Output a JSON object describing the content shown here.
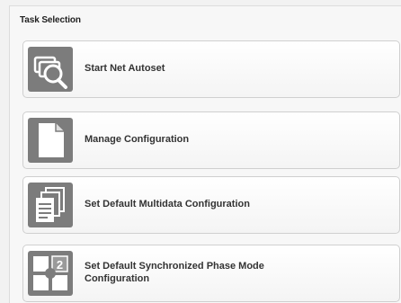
{
  "panel": {
    "title": "Task Selection"
  },
  "tasks": [
    {
      "label": "Start Net Autoset",
      "icon": "net-autoset-search-icon"
    },
    {
      "label": "Manage Configuration",
      "icon": "document-icon"
    },
    {
      "label": "Set Default Multidata Configuration",
      "icon": "multiple-documents-icon"
    },
    {
      "label_line1": "Set Default Synchronized Phase Mode",
      "label_line2": "Configuration",
      "icon": "phase-mode-quadrant-icon",
      "icon_text": "2"
    }
  ],
  "colors": {
    "icon_background": "#7c7c7c",
    "icon_foreground": "#ffffff",
    "label_text": "#333333"
  }
}
